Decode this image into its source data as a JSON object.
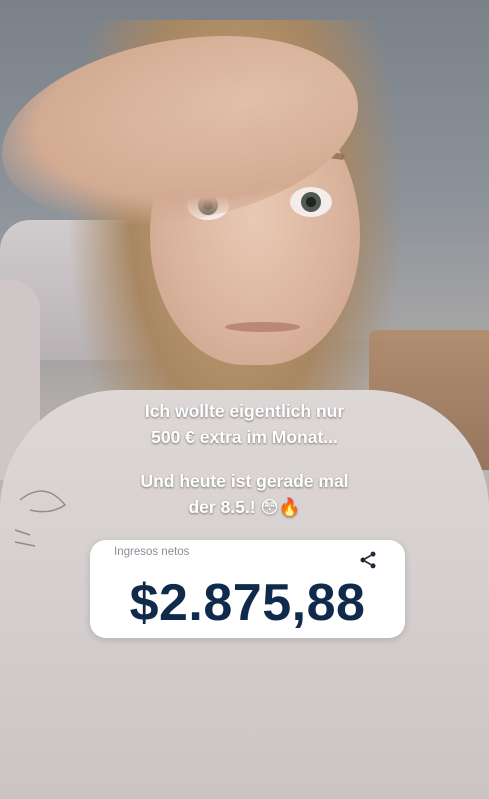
{
  "caption": {
    "line1": "Ich wollte eigentlich nur",
    "line2": "500 € extra im Monat...",
    "line3": "Und heute ist gerade mal",
    "line4": "der 8.5.! 😳🔥"
  },
  "earnings_card": {
    "label": "Ingresos netos",
    "amount": "$2.875,88",
    "share_icon": "share-icon"
  },
  "colors": {
    "amount_text": "#0f2a4a",
    "label_text": "#8a8f98",
    "card_bg": "#ffffff",
    "caption_text": "#ffffff"
  }
}
